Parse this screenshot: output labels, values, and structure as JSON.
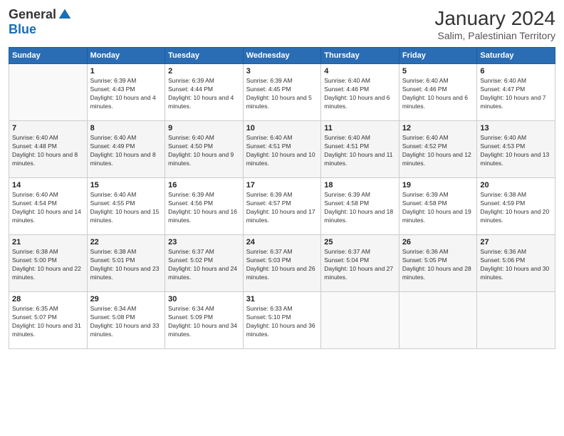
{
  "logo": {
    "general": "General",
    "blue": "Blue"
  },
  "title": "January 2024",
  "subtitle": "Salim, Palestinian Territory",
  "days_header": [
    "Sunday",
    "Monday",
    "Tuesday",
    "Wednesday",
    "Thursday",
    "Friday",
    "Saturday"
  ],
  "weeks": [
    [
      {
        "day": "",
        "sunrise": "",
        "sunset": "",
        "daylight": ""
      },
      {
        "day": "1",
        "sunrise": "Sunrise: 6:39 AM",
        "sunset": "Sunset: 4:43 PM",
        "daylight": "Daylight: 10 hours and 4 minutes."
      },
      {
        "day": "2",
        "sunrise": "Sunrise: 6:39 AM",
        "sunset": "Sunset: 4:44 PM",
        "daylight": "Daylight: 10 hours and 4 minutes."
      },
      {
        "day": "3",
        "sunrise": "Sunrise: 6:39 AM",
        "sunset": "Sunset: 4:45 PM",
        "daylight": "Daylight: 10 hours and 5 minutes."
      },
      {
        "day": "4",
        "sunrise": "Sunrise: 6:40 AM",
        "sunset": "Sunset: 4:46 PM",
        "daylight": "Daylight: 10 hours and 6 minutes."
      },
      {
        "day": "5",
        "sunrise": "Sunrise: 6:40 AM",
        "sunset": "Sunset: 4:46 PM",
        "daylight": "Daylight: 10 hours and 6 minutes."
      },
      {
        "day": "6",
        "sunrise": "Sunrise: 6:40 AM",
        "sunset": "Sunset: 4:47 PM",
        "daylight": "Daylight: 10 hours and 7 minutes."
      }
    ],
    [
      {
        "day": "7",
        "sunrise": "Sunrise: 6:40 AM",
        "sunset": "Sunset: 4:48 PM",
        "daylight": "Daylight: 10 hours and 8 minutes."
      },
      {
        "day": "8",
        "sunrise": "Sunrise: 6:40 AM",
        "sunset": "Sunset: 4:49 PM",
        "daylight": "Daylight: 10 hours and 8 minutes."
      },
      {
        "day": "9",
        "sunrise": "Sunrise: 6:40 AM",
        "sunset": "Sunset: 4:50 PM",
        "daylight": "Daylight: 10 hours and 9 minutes."
      },
      {
        "day": "10",
        "sunrise": "Sunrise: 6:40 AM",
        "sunset": "Sunset: 4:51 PM",
        "daylight": "Daylight: 10 hours and 10 minutes."
      },
      {
        "day": "11",
        "sunrise": "Sunrise: 6:40 AM",
        "sunset": "Sunset: 4:51 PM",
        "daylight": "Daylight: 10 hours and 11 minutes."
      },
      {
        "day": "12",
        "sunrise": "Sunrise: 6:40 AM",
        "sunset": "Sunset: 4:52 PM",
        "daylight": "Daylight: 10 hours and 12 minutes."
      },
      {
        "day": "13",
        "sunrise": "Sunrise: 6:40 AM",
        "sunset": "Sunset: 4:53 PM",
        "daylight": "Daylight: 10 hours and 13 minutes."
      }
    ],
    [
      {
        "day": "14",
        "sunrise": "Sunrise: 6:40 AM",
        "sunset": "Sunset: 4:54 PM",
        "daylight": "Daylight: 10 hours and 14 minutes."
      },
      {
        "day": "15",
        "sunrise": "Sunrise: 6:40 AM",
        "sunset": "Sunset: 4:55 PM",
        "daylight": "Daylight: 10 hours and 15 minutes."
      },
      {
        "day": "16",
        "sunrise": "Sunrise: 6:39 AM",
        "sunset": "Sunset: 4:56 PM",
        "daylight": "Daylight: 10 hours and 16 minutes."
      },
      {
        "day": "17",
        "sunrise": "Sunrise: 6:39 AM",
        "sunset": "Sunset: 4:57 PM",
        "daylight": "Daylight: 10 hours and 17 minutes."
      },
      {
        "day": "18",
        "sunrise": "Sunrise: 6:39 AM",
        "sunset": "Sunset: 4:58 PM",
        "daylight": "Daylight: 10 hours and 18 minutes."
      },
      {
        "day": "19",
        "sunrise": "Sunrise: 6:39 AM",
        "sunset": "Sunset: 4:58 PM",
        "daylight": "Daylight: 10 hours and 19 minutes."
      },
      {
        "day": "20",
        "sunrise": "Sunrise: 6:38 AM",
        "sunset": "Sunset: 4:59 PM",
        "daylight": "Daylight: 10 hours and 20 minutes."
      }
    ],
    [
      {
        "day": "21",
        "sunrise": "Sunrise: 6:38 AM",
        "sunset": "Sunset: 5:00 PM",
        "daylight": "Daylight: 10 hours and 22 minutes."
      },
      {
        "day": "22",
        "sunrise": "Sunrise: 6:38 AM",
        "sunset": "Sunset: 5:01 PM",
        "daylight": "Daylight: 10 hours and 23 minutes."
      },
      {
        "day": "23",
        "sunrise": "Sunrise: 6:37 AM",
        "sunset": "Sunset: 5:02 PM",
        "daylight": "Daylight: 10 hours and 24 minutes."
      },
      {
        "day": "24",
        "sunrise": "Sunrise: 6:37 AM",
        "sunset": "Sunset: 5:03 PM",
        "daylight": "Daylight: 10 hours and 26 minutes."
      },
      {
        "day": "25",
        "sunrise": "Sunrise: 6:37 AM",
        "sunset": "Sunset: 5:04 PM",
        "daylight": "Daylight: 10 hours and 27 minutes."
      },
      {
        "day": "26",
        "sunrise": "Sunrise: 6:36 AM",
        "sunset": "Sunset: 5:05 PM",
        "daylight": "Daylight: 10 hours and 28 minutes."
      },
      {
        "day": "27",
        "sunrise": "Sunrise: 6:36 AM",
        "sunset": "Sunset: 5:06 PM",
        "daylight": "Daylight: 10 hours and 30 minutes."
      }
    ],
    [
      {
        "day": "28",
        "sunrise": "Sunrise: 6:35 AM",
        "sunset": "Sunset: 5:07 PM",
        "daylight": "Daylight: 10 hours and 31 minutes."
      },
      {
        "day": "29",
        "sunrise": "Sunrise: 6:34 AM",
        "sunset": "Sunset: 5:08 PM",
        "daylight": "Daylight: 10 hours and 33 minutes."
      },
      {
        "day": "30",
        "sunrise": "Sunrise: 6:34 AM",
        "sunset": "Sunset: 5:09 PM",
        "daylight": "Daylight: 10 hours and 34 minutes."
      },
      {
        "day": "31",
        "sunrise": "Sunrise: 6:33 AM",
        "sunset": "Sunset: 5:10 PM",
        "daylight": "Daylight: 10 hours and 36 minutes."
      },
      {
        "day": "",
        "sunrise": "",
        "sunset": "",
        "daylight": ""
      },
      {
        "day": "",
        "sunrise": "",
        "sunset": "",
        "daylight": ""
      },
      {
        "day": "",
        "sunrise": "",
        "sunset": "",
        "daylight": ""
      }
    ]
  ]
}
